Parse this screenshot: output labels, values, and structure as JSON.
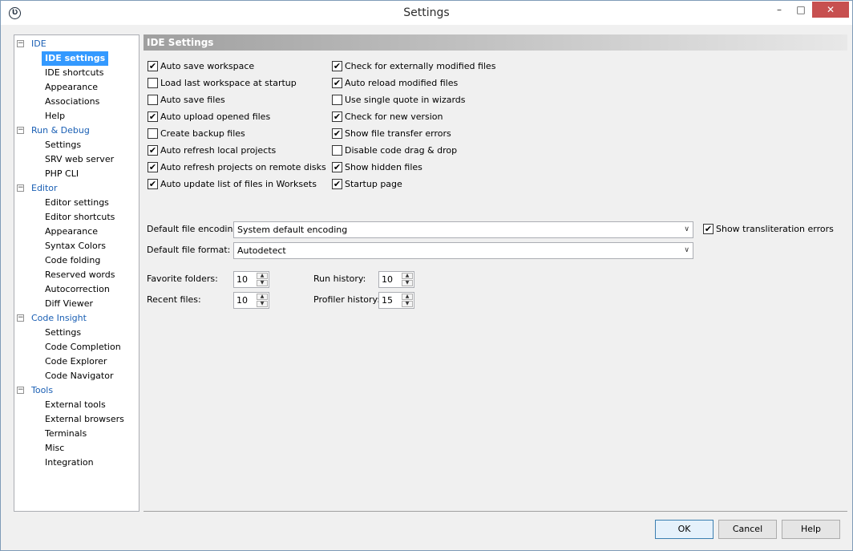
{
  "window": {
    "title": "Settings",
    "app_icon_glyph": "Ʋ",
    "minimize_glyph": "–",
    "maximize_glyph": "□",
    "close_glyph": "✕"
  },
  "tree": {
    "toggle_glyph": "−",
    "categories": [
      {
        "label": "IDE",
        "children": [
          "IDE settings",
          "IDE shortcuts",
          "Appearance",
          "Associations",
          "Help"
        ]
      },
      {
        "label": "Run & Debug",
        "children": [
          "Settings",
          "SRV web server",
          "PHP CLI"
        ]
      },
      {
        "label": "Editor",
        "children": [
          "Editor settings",
          "Editor shortcuts",
          "Appearance",
          "Syntax Colors",
          "Code folding",
          "Reserved words",
          "Autocorrection",
          "Diff Viewer"
        ]
      },
      {
        "label": "Code Insight",
        "children": [
          "Settings",
          "Code Completion",
          "Code Explorer",
          "Code Navigator"
        ]
      },
      {
        "label": "Tools",
        "children": [
          "External tools",
          "External browsers",
          "Terminals",
          "Misc",
          "Integration"
        ]
      }
    ],
    "selected": "IDE settings"
  },
  "panel": {
    "header": "IDE Settings",
    "check_glyph": "✔",
    "left_checkboxes": [
      {
        "label": "Auto save workspace",
        "checked": true
      },
      {
        "label": "Load last workspace at startup",
        "checked": false
      },
      {
        "label": "Auto save files",
        "checked": false
      },
      {
        "label": "Auto upload opened files",
        "checked": true
      },
      {
        "label": "Create backup files",
        "checked": false
      },
      {
        "label": "Auto refresh local projects",
        "checked": true
      },
      {
        "label": "Auto refresh projects on remote disks",
        "checked": true
      },
      {
        "label": "Auto update list of files in Worksets",
        "checked": true
      }
    ],
    "right_checkboxes": [
      {
        "label": "Check for externally modified files",
        "checked": true
      },
      {
        "label": "Auto reload modified files",
        "checked": true
      },
      {
        "label": "Use single quote in wizards",
        "checked": false
      },
      {
        "label": "Check for new version",
        "checked": true
      },
      {
        "label": "Show file transfer errors",
        "checked": true
      },
      {
        "label": "Disable code drag & drop",
        "checked": false
      },
      {
        "label": "Show hidden files",
        "checked": true
      },
      {
        "label": "Startup page",
        "checked": true
      }
    ],
    "encoding_label": "Default file encoding:",
    "encoding_value": "System default encoding",
    "format_label": "Default file format:",
    "format_value": "Autodetect",
    "translit_label": "Show transliteration errors",
    "translit_checked": true,
    "dropdown_glyph": "∨",
    "spin_up_glyph": "▲",
    "spin_down_glyph": "▼",
    "favorite_folders_label": "Favorite folders:",
    "favorite_folders_value": "10",
    "recent_files_label": "Recent files:",
    "recent_files_value": "10",
    "run_history_label": "Run history:",
    "run_history_value": "10",
    "profiler_history_label": "Profiler history:",
    "profiler_history_value": "15"
  },
  "buttons": {
    "ok": "OK",
    "cancel": "Cancel",
    "help": "Help"
  }
}
